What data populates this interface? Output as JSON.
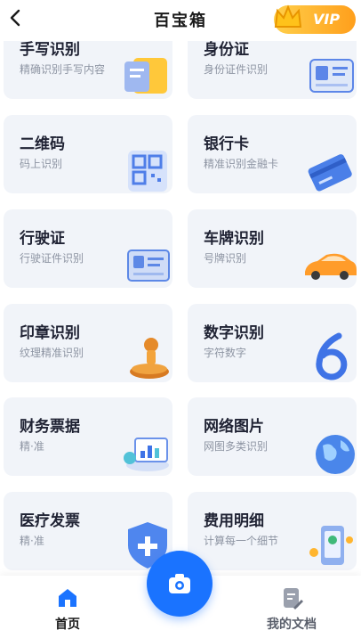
{
  "header": {
    "title": "百宝箱",
    "vip_label": "VIP"
  },
  "cards": [
    {
      "name": "手写识别",
      "desc": "精确识别手写内容"
    },
    {
      "name": "身份证",
      "desc": "身份证件识别"
    },
    {
      "name": "二维码",
      "desc": "码上识别"
    },
    {
      "name": "银行卡",
      "desc": "精准识别金融卡"
    },
    {
      "name": "行驶证",
      "desc": "行驶证件识别"
    },
    {
      "name": "车牌识别",
      "desc": "号牌识别"
    },
    {
      "name": "印章识别",
      "desc": "纹理精准识别"
    },
    {
      "name": "数字识别",
      "desc": "字符数字"
    },
    {
      "name": "财务票据",
      "desc": "精·准"
    },
    {
      "name": "网络图片",
      "desc": "网图多类识别"
    },
    {
      "name": "医疗发票",
      "desc": "精·准"
    },
    {
      "name": "费用明细",
      "desc": "计算每一个细节"
    }
  ],
  "tabbar": {
    "home_label": "首页",
    "docs_label": "我的文档"
  },
  "colors": {
    "accent": "#1a73ff",
    "card_bg": "#f1f4f9",
    "vip": "#ffb52e"
  }
}
